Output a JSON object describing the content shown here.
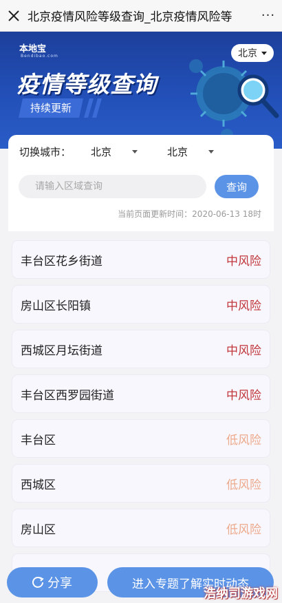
{
  "topbar": {
    "title": "北京疫情风险等级查询_北京疫情风险等",
    "close_icon": "close-icon",
    "more_label": "···"
  },
  "banner": {
    "logo": "本地宝",
    "logo_sub": "Bendibao.com",
    "title": "疫情等级查询",
    "tag": "持续更新",
    "city": "北京"
  },
  "filter": {
    "city_label": "切换城市：",
    "province": "北京",
    "city": "北京",
    "search_placeholder": "请输入区域查询",
    "search_button": "查询",
    "updated": "当前页面更新时间：2020-06-13 18时"
  },
  "items": [
    {
      "name": "丰台区花乡街道",
      "risk": "中风险",
      "level": "mid"
    },
    {
      "name": "房山区长阳镇",
      "risk": "中风险",
      "level": "mid"
    },
    {
      "name": "西城区月坛街道",
      "risk": "中风险",
      "level": "mid"
    },
    {
      "name": "丰台区西罗园街道",
      "risk": "中风险",
      "level": "mid"
    },
    {
      "name": "丰台区",
      "risk": "低风险",
      "level": "low"
    },
    {
      "name": "西城区",
      "risk": "低风险",
      "level": "low"
    },
    {
      "name": "房山区",
      "risk": "低风险",
      "level": "low"
    },
    {
      "name": "",
      "risk": "",
      "level": "low"
    }
  ],
  "bottom": {
    "share": "分享",
    "topic": "进入专题了解实时动态"
  },
  "watermark": "浩纳司游戏网",
  "colors": {
    "accent": "#5b93e6",
    "mid_risk": "#c0353a",
    "low_risk": "#eda98b",
    "banner": "#2250b8"
  }
}
